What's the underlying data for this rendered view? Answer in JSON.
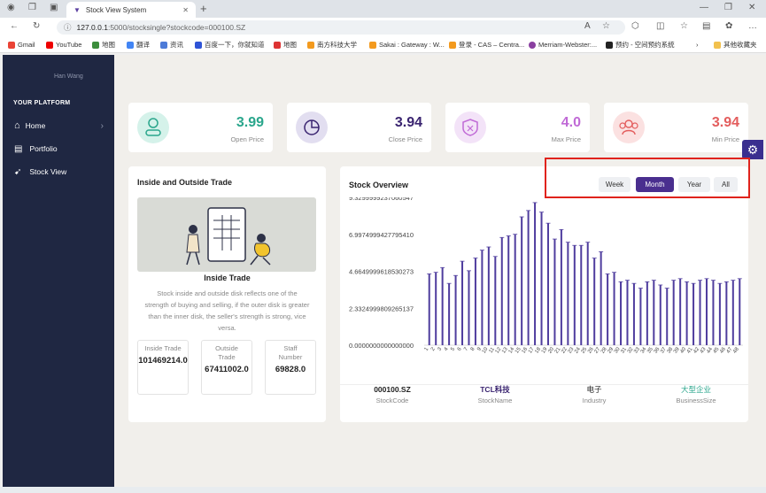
{
  "browser": {
    "tab_title": "Stock View System",
    "url_host": "127.0.0.1",
    "url_rest": ":5000/stocksingle?stockcode=000100.SZ",
    "bookmarks": [
      "Gmail",
      "YouTube",
      "地图",
      "翻译",
      "资讯",
      "百度一下，你就知道",
      "地图",
      "南方科技大学",
      "Sakai : Gateway : W...",
      "登录 - CAS – Centra...",
      "Merriam-Webster:...",
      "预约 - 空间预约系统"
    ],
    "other_bookmarks": "其他收藏夹"
  },
  "sidebar": {
    "user": "Han Wang",
    "section": "YOUR PLATFORM",
    "items": [
      {
        "label": "Home"
      },
      {
        "label": "Portfolio"
      },
      {
        "label": "Stock View"
      }
    ]
  },
  "stats": [
    {
      "value": "3.99",
      "label": "Open Price",
      "color": "#2aa68c",
      "bg": "#d5f2ea"
    },
    {
      "value": "3.94",
      "label": "Close Price",
      "color": "#3a2470",
      "bg": "#e2def0"
    },
    {
      "value": "4.0",
      "label": "Max Price",
      "color": "#c06ad6",
      "bg": "#f3e3f8"
    },
    {
      "value": "3.94",
      "label": "Min Price",
      "color": "#e35d5d",
      "bg": "#fbe1e1"
    }
  ],
  "trade_panel": {
    "title": "Inside and Outside Trade",
    "image_title": "Inside Trade",
    "description": "Stock inside and outside disk reflects one of the strength of buying and selling, if the outer disk is greater than the inner disk, the seller's strength is strong, vice versa.",
    "metrics": [
      {
        "label": "Inside Trade",
        "value": "101469214.0"
      },
      {
        "label": "Outside Trade",
        "value": "67411002.0"
      },
      {
        "label": "Staff Number",
        "value": "69828.0"
      }
    ]
  },
  "overview": {
    "title": "Stock Overview",
    "ranges": [
      "Week",
      "Month",
      "Year",
      "All"
    ],
    "active_range": "Month",
    "info": [
      {
        "value": "000100.SZ",
        "label": "StockCode",
        "color": "#222"
      },
      {
        "value": "TCL科技",
        "label": "StockName",
        "color": "#3a2470"
      },
      {
        "value": "电子",
        "label": "Industry",
        "color": "#222"
      },
      {
        "value": "大型企业",
        "label": "BusinessSize",
        "color": "#2aa68c"
      }
    ]
  },
  "chart_data": {
    "type": "bar",
    "categories": [
      "1",
      "2",
      "3",
      "4",
      "5",
      "6",
      "7",
      "8",
      "9",
      "10",
      "11",
      "12",
      "13",
      "14",
      "15",
      "16",
      "17",
      "18",
      "19",
      "20",
      "21",
      "22",
      "23",
      "24",
      "25",
      "26",
      "27",
      "28",
      "29",
      "30",
      "31",
      "32",
      "33",
      "34",
      "35",
      "36",
      "37",
      "38",
      "39",
      "40",
      "41",
      "42",
      "43",
      "44",
      "45",
      "46",
      "47",
      "48"
    ],
    "values": [
      4.5,
      4.6,
      4.9,
      3.9,
      4.4,
      5.3,
      4.7,
      5.5,
      6.0,
      6.2,
      5.6,
      6.8,
      6.9,
      7.0,
      8.1,
      8.5,
      9.0,
      8.4,
      7.7,
      6.7,
      7.3,
      6.5,
      6.3,
      6.3,
      6.5,
      5.5,
      5.9,
      4.5,
      4.6,
      4.0,
      4.1,
      3.9,
      3.6,
      4.0,
      4.1,
      3.8,
      3.6,
      4.1,
      4.2,
      4.0,
      3.9,
      4.1,
      4.2,
      4.1,
      3.9,
      4.0,
      4.1,
      4.2
    ],
    "yticks": [
      "0.0000000000000000",
      "2.3324999809265137",
      "4.6649999618530273",
      "6.9974999427795410",
      "9.3299999237060547"
    ],
    "ylim": [
      0,
      9.329999923706055
    ],
    "color": "#4f3d9e"
  }
}
